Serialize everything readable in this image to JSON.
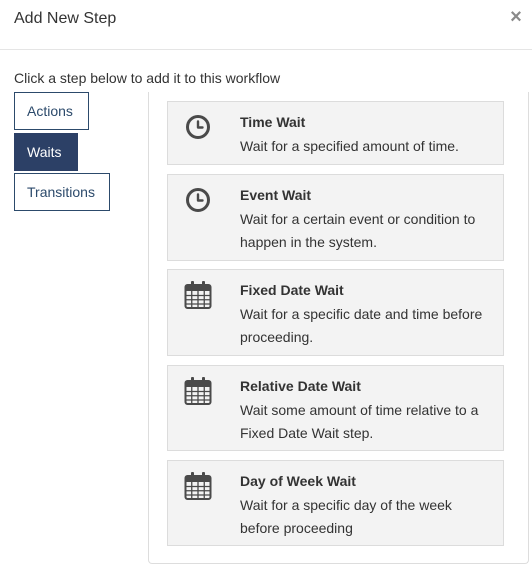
{
  "header": {
    "title": "Add New Step",
    "close_label": "×"
  },
  "instruction": "Click a step below to add it to this workflow",
  "tabs": [
    {
      "label": "Actions",
      "active": false
    },
    {
      "label": "Waits",
      "active": true
    },
    {
      "label": "Transitions",
      "active": false
    }
  ],
  "steps": [
    {
      "title": "Time Wait",
      "description": "Wait for a specified amount of time.",
      "icon": "clock-icon"
    },
    {
      "title": "Event Wait",
      "description": "Wait for a certain event or condition to happen in the system.",
      "icon": "clock-icon"
    },
    {
      "title": "Fixed Date Wait",
      "description": "Wait for a specific date and time before proceeding.",
      "icon": "calendar-icon"
    },
    {
      "title": "Relative Date Wait",
      "description": "Wait some amount of time relative to a Fixed Date Wait step.",
      "icon": "calendar-icon"
    },
    {
      "title": "Day of Week Wait",
      "description": "Wait for a specific day of the week before proceeding",
      "icon": "calendar-icon"
    }
  ],
  "colors": {
    "accent": "#2c4066",
    "card_bg": "#f3f3f3",
    "icon": "#4a4a4a"
  }
}
